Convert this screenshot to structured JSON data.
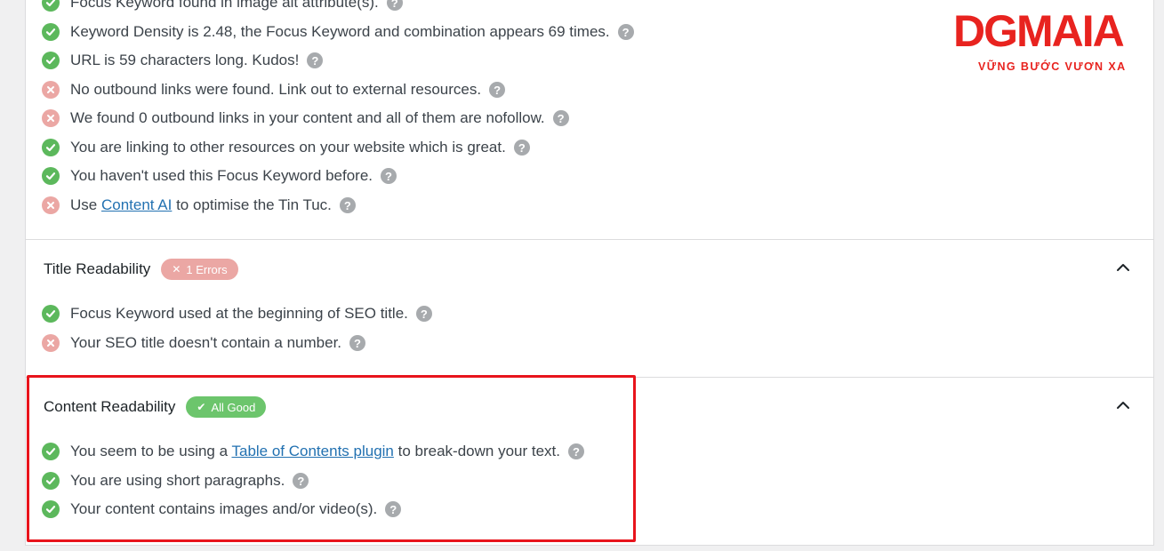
{
  "logo": {
    "brand": "DGMAIA",
    "tagline": "VỮNG BƯỚC VƯƠN XA"
  },
  "keyword_section": {
    "items": [
      {
        "status": "ok",
        "text": "Focus Keyword found in image alt attribute(s)."
      },
      {
        "status": "ok",
        "text": "Keyword Density is 2.48, the Focus Keyword and combination appears 69 times."
      },
      {
        "status": "ok",
        "text": "URL is 59 characters long. Kudos!"
      },
      {
        "status": "err",
        "text": "No outbound links were found. Link out to external resources."
      },
      {
        "status": "err",
        "text": "We found 0 outbound links in your content and all of them are nofollow."
      },
      {
        "status": "ok",
        "text": "You are linking to other resources on your website which is great."
      },
      {
        "status": "ok",
        "text": "You haven't used this Focus Keyword before."
      },
      {
        "status": "err",
        "before": "Use ",
        "link": "Content AI",
        "after": " to optimise the Tin Tuc."
      }
    ]
  },
  "title_readability": {
    "title": "Title Readability",
    "badge": "1 Errors",
    "items": [
      {
        "status": "ok",
        "text": "Focus Keyword used at the beginning of SEO title."
      },
      {
        "status": "err",
        "text": "Your SEO title doesn't contain a number."
      }
    ]
  },
  "content_readability": {
    "title": "Content Readability",
    "badge": "All Good",
    "items": [
      {
        "status": "ok",
        "before": "You seem to be using a ",
        "link": "Table of Contents plugin",
        "after": " to break-down your text."
      },
      {
        "status": "ok",
        "text": "You are using short paragraphs."
      },
      {
        "status": "ok",
        "text": "Your content contains images and/or video(s)."
      }
    ]
  },
  "help_glyph": "?",
  "colors": {
    "ok": "#5cb85c",
    "err": "#eba7a4",
    "link": "#2271b1",
    "highlight": "#e8141c",
    "brand": "#e8231f"
  },
  "icons": {
    "ok": "check-circle-icon",
    "err": "cross-circle-icon",
    "help": "help-icon",
    "collapse": "chevron-up-icon"
  }
}
